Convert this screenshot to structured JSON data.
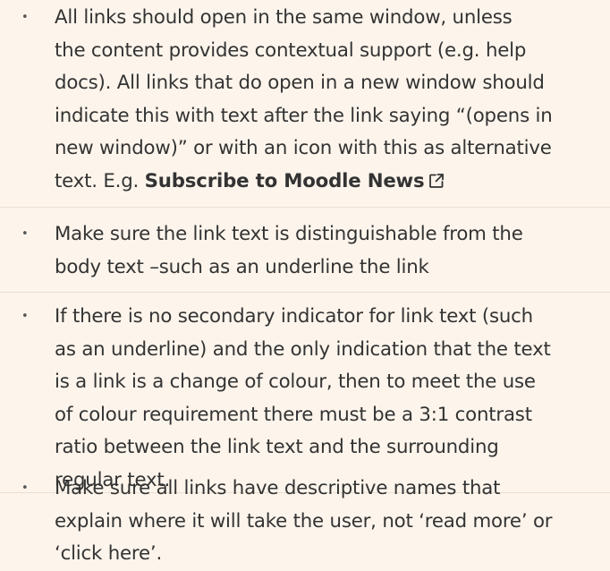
{
  "items": [
    {
      "lines": [
        "All links should open in the same window, unless",
        "the content provides contextual support (e.g. help",
        "docs). All links that do open in a new window should",
        "indicate this with text after the link saying “(opens in",
        "new window)” or with an icon with this as alternative"
      ],
      "last_line_prefix": "text. E.g. ",
      "link_text": "Subscribe to Moodle News"
    },
    {
      "lines": [
        "Make sure the link text is distinguishable from the",
        "body text –such as an underline the link"
      ]
    },
    {
      "lines": [
        "If there is no secondary indicator for link text (such",
        "as an underline) and the only indication that the text",
        "is a link is a change of colour, then to meet the use",
        "of colour requirement there must be a 3:1 contrast",
        "ratio between the link text and the surrounding",
        "regular text."
      ]
    },
    {
      "lines": [
        "Make sure all links have descriptive names that",
        "explain where it will take the user, not ‘read more’ or",
        "‘click here’."
      ]
    }
  ],
  "icons": {
    "external_link": "external-link-icon"
  },
  "colors": {
    "background": "#fdf5ec",
    "text": "#333333",
    "separator": "#e9dfd3"
  }
}
